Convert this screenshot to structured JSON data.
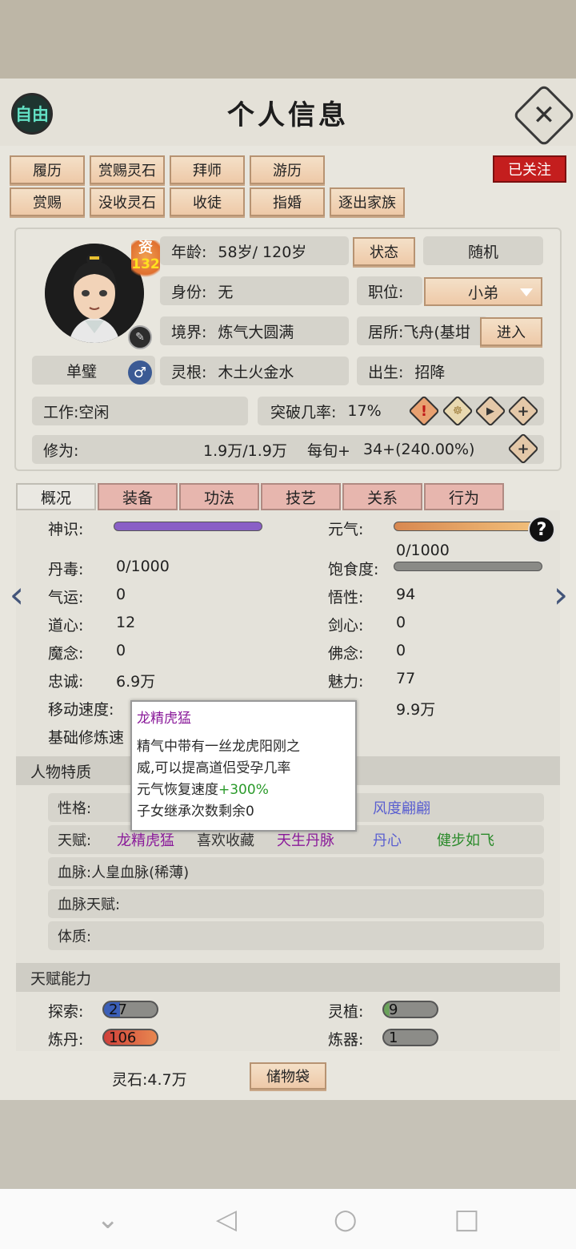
{
  "header": {
    "free_badge": "自由",
    "title": "个人信息",
    "followed": "已关注"
  },
  "actions": {
    "row1": [
      "履历",
      "赏赐灵石",
      "拜师",
      "游历"
    ],
    "row2": [
      "赏赐",
      "没收灵石",
      "收徒",
      "指婚",
      "逐出家族"
    ]
  },
  "profile": {
    "rank_label": "资",
    "rank_value": "132",
    "name": "单璧",
    "gender_symbol": "♂",
    "age_label": "年龄:",
    "age_value": "58岁/ 120岁",
    "status_button": "状态",
    "random_button": "随机",
    "identity_label": "身份:",
    "identity_value": "无",
    "position_label": "职位:",
    "position_value": "小弟",
    "realm_label": "境界:",
    "realm_value": "炼气大圆满",
    "residence_label": "居所:",
    "residence_value": "飞舟(基坩",
    "enter_button": "进入",
    "root_label": "灵根:",
    "root_value": "木土火金水",
    "birth_label": "出生:",
    "birth_value": "招降",
    "work_label": "工作:",
    "work_value": "空闲",
    "breakthrough_label": "突破几率:",
    "breakthrough_value": "17%",
    "cultivation_label": "修为:",
    "cultivation_value": "1.9万/1.9万",
    "per_turn_label": "每旬+",
    "per_turn_value": "34+(240.00%)"
  },
  "tabs": [
    "概况",
    "装备",
    "功法",
    "技艺",
    "关系",
    "行为"
  ],
  "stats": {
    "shenshi_label": "神识:",
    "yuanqi_label": "元气:",
    "yuanqi_value": "0/1000",
    "dandu_label": "丹毒:",
    "dandu_value": "0/1000",
    "baoshi_label": "饱食度:",
    "qiyun_label": "气运:",
    "qiyun_value": "0",
    "wuxing_label": "悟性:",
    "wuxing_value": "94",
    "daoxin_label": "道心:",
    "daoxin_value": "12",
    "jianxin_label": "剑心:",
    "jianxin_value": "0",
    "monian_label": "魔念:",
    "monian_value": "0",
    "fonian_label": "佛念:",
    "fonian_value": "0",
    "zhongcheng_label": "忠诚:",
    "zhongcheng_value": "6.9万",
    "meili_label": "魅力:",
    "meili_value": "77",
    "speed_label": "移动速度:",
    "power_value": "9.9万",
    "base_label": "基础修炼速"
  },
  "traits": {
    "section_title": "人物特质",
    "personality_label": "性格:",
    "personality_value": "风度翩翩",
    "talent_label": "天赋:",
    "talents": [
      "龙精虎猛",
      "喜欢收藏",
      "天生丹脉",
      "丹心",
      "健步如飞"
    ],
    "bloodline_label": "血脉:",
    "bloodline_value": "人皇血脉(稀薄)",
    "bloodline_talent_label": "血脉天赋:",
    "physique_label": "体质:"
  },
  "abilities": {
    "section_title": "天赋能力",
    "explore_label": "探索:",
    "explore_value": "27",
    "plant_label": "灵植:",
    "plant_value": "9",
    "alchemy_label": "炼丹:",
    "alchemy_value": "106",
    "forge_label": "炼器:",
    "forge_value": "1"
  },
  "footer": {
    "spirit_stone": "灵石:4.7万",
    "bag_button": "储物袋"
  },
  "tooltip": {
    "title": "龙精虎猛",
    "line1": "精气中带有一丝龙虎阳刚之",
    "line2": "威,可以提高道侣受孕几率",
    "line3_prefix": "元气恢复速度",
    "line3_bonus": "+300%",
    "line4": "子女继承次数剩余0"
  },
  "colors": {
    "shenshi_bar": "#8a5fc6",
    "yuanqi_bar": "#e9a85a",
    "accent_red": "#c41e1e"
  }
}
